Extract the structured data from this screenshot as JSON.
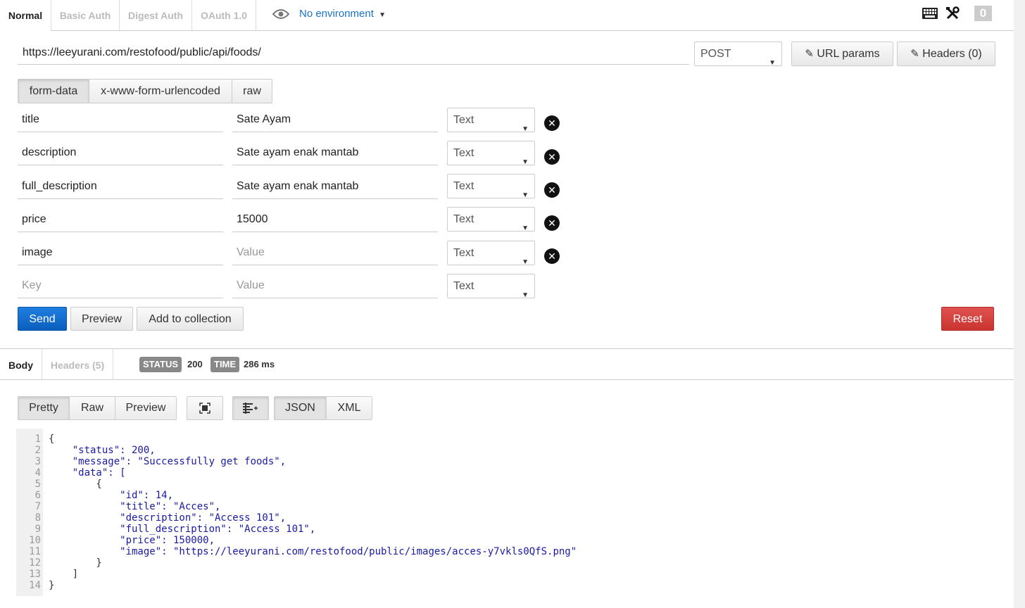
{
  "auth_tabs": [
    "Normal",
    "Basic Auth",
    "Digest Auth",
    "OAuth 1.0"
  ],
  "environment": "No environment",
  "counter": "0",
  "request": {
    "url": "https://leeyurani.com/restofood/public/api/foods/",
    "method": "POST",
    "url_params_label": "URL params",
    "headers_label": "Headers (0)"
  },
  "body_tabs": [
    "form-data",
    "x-www-form-urlencoded",
    "raw"
  ],
  "form_rows": [
    {
      "key": "title",
      "value": "Sate Ayam",
      "type": "Text"
    },
    {
      "key": "description",
      "value": "Sate ayam enak mantab",
      "type": "Text"
    },
    {
      "key": "full_description",
      "value": "Sate ayam enak mantab",
      "type": "Text"
    },
    {
      "key": "price",
      "value": "15000",
      "type": "Text"
    },
    {
      "key": "image",
      "value": "",
      "type": "Text"
    }
  ],
  "new_row": {
    "key_placeholder": "Key",
    "value_placeholder": "Value",
    "type": "Text"
  },
  "value_placeholder": "Value",
  "actions": {
    "send": "Send",
    "preview": "Preview",
    "add_to_collection": "Add to collection",
    "reset": "Reset"
  },
  "response": {
    "tabs": [
      "Body",
      "Headers (5)"
    ],
    "status_label": "STATUS",
    "status_value": "200",
    "time_label": "TIME",
    "time_value": "286 ms",
    "view_tabs": [
      "Pretty",
      "Raw",
      "Preview"
    ],
    "format_tabs": [
      "JSON",
      "XML"
    ]
  },
  "code_lines": [
    {
      "n": "1",
      "text": "{"
    },
    {
      "n": "2",
      "text": "    \"status\": 200,"
    },
    {
      "n": "3",
      "text": "    \"message\": \"Successfully get foods\","
    },
    {
      "n": "4",
      "text": "    \"data\": ["
    },
    {
      "n": "5",
      "text": "        {"
    },
    {
      "n": "6",
      "text": "            \"id\": 14,"
    },
    {
      "n": "7",
      "text": "            \"title\": \"Acces\","
    },
    {
      "n": "8",
      "text": "            \"description\": \"Access 101\","
    },
    {
      "n": "9",
      "text": "            \"full_description\": \"Access 101\","
    },
    {
      "n": "10",
      "text": "            \"price\": 150000,"
    },
    {
      "n": "11",
      "text": "            \"image\": \"https://leeyurani.com/restofood/public/images/acces-y7vkls0QfS.png\""
    },
    {
      "n": "12",
      "text": "        }"
    },
    {
      "n": "13",
      "text": "    ]"
    },
    {
      "n": "14",
      "text": "}"
    }
  ],
  "colors": {
    "send": "#0b5fbd",
    "reset": "#c93430",
    "link": "#1a73c8",
    "json_key": "#1a1aa6",
    "json_number": "#116644"
  }
}
